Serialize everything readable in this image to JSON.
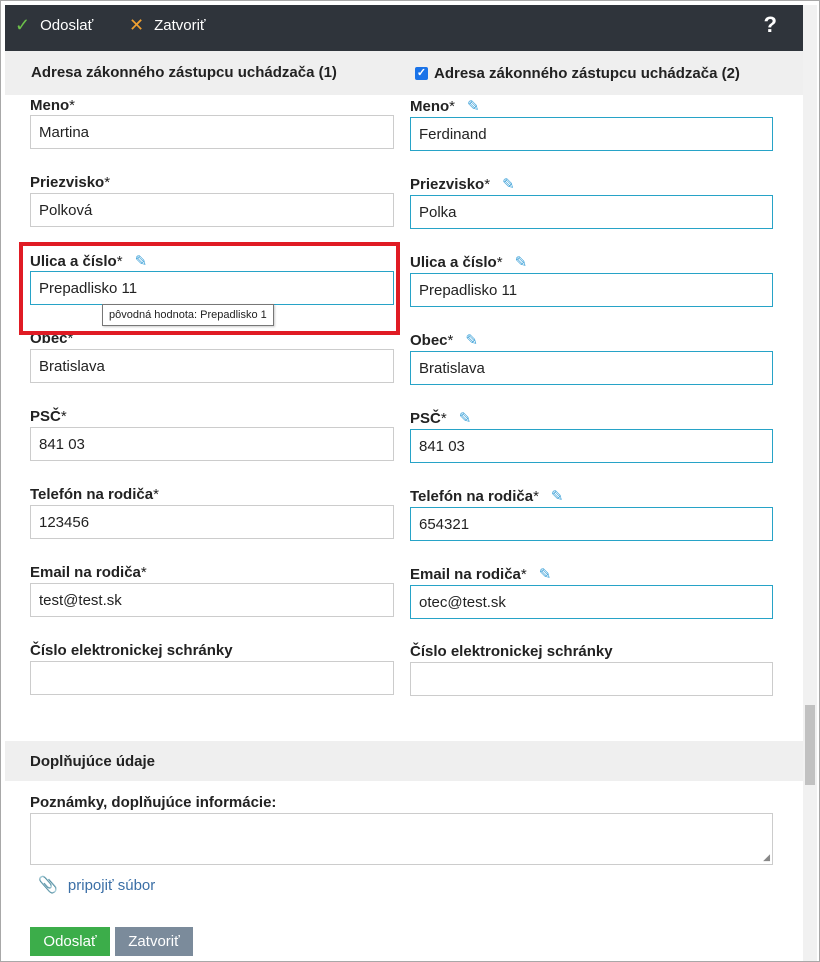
{
  "toolbar": {
    "send_label": "Odoslať",
    "close_label": "Zatvoriť",
    "help_label": "?"
  },
  "columns": {
    "left_title": "Adresa zákonného zástupcu uchádzača (1)",
    "right_title": "Adresa zákonného zástupcu uchádzača (2)"
  },
  "left": {
    "meno_label": "Meno",
    "meno_value": "Martina",
    "priezvisko_label": "Priezvisko",
    "priezvisko_value": "Polková",
    "ulica_label": "Ulica a číslo",
    "ulica_value": "Prepadlisko 11",
    "obec_label": "Obec",
    "obec_value": "Bratislava",
    "psc_label": "PSČ",
    "psc_value": "841 03",
    "telefon_label": "Telefón na rodiča",
    "telefon_value": "123456",
    "email_label": "Email na rodiča",
    "email_value": "test@test.sk",
    "schranka_label": "Číslo elektronickej schránky",
    "schranka_value": ""
  },
  "right": {
    "meno_label": "Meno",
    "meno_value": "Ferdinand",
    "priezvisko_label": "Priezvisko",
    "priezvisko_value": "Polka",
    "ulica_label": "Ulica a číslo",
    "ulica_value": "Prepadlisko 11",
    "obec_label": "Obec",
    "obec_value": "Bratislava",
    "psc_label": "PSČ",
    "psc_value": "841 03",
    "telefon_label": "Telefón na rodiča",
    "telefon_value": "654321",
    "email_label": "Email na rodiča",
    "email_value": "otec@test.sk",
    "schranka_label": "Číslo elektronickej schránky",
    "schranka_value": ""
  },
  "required_mark": "*",
  "tooltip": "pôvodná hodnota: Prepadlisko 1",
  "extra": {
    "title": "Doplňujúce údaje",
    "notes_label": "Poznámky, doplňujúce informácie:",
    "attach_label": "pripojiť súbor"
  },
  "footer": {
    "send_label": "Odoslať",
    "close_label": "Zatvoriť"
  },
  "colors": {
    "toolbar_bg": "#2f343b",
    "check_green": "#3cad4a",
    "close_orange": "#f0a030",
    "changed_border": "#27a3c7",
    "highlight_red": "#e01b24"
  }
}
